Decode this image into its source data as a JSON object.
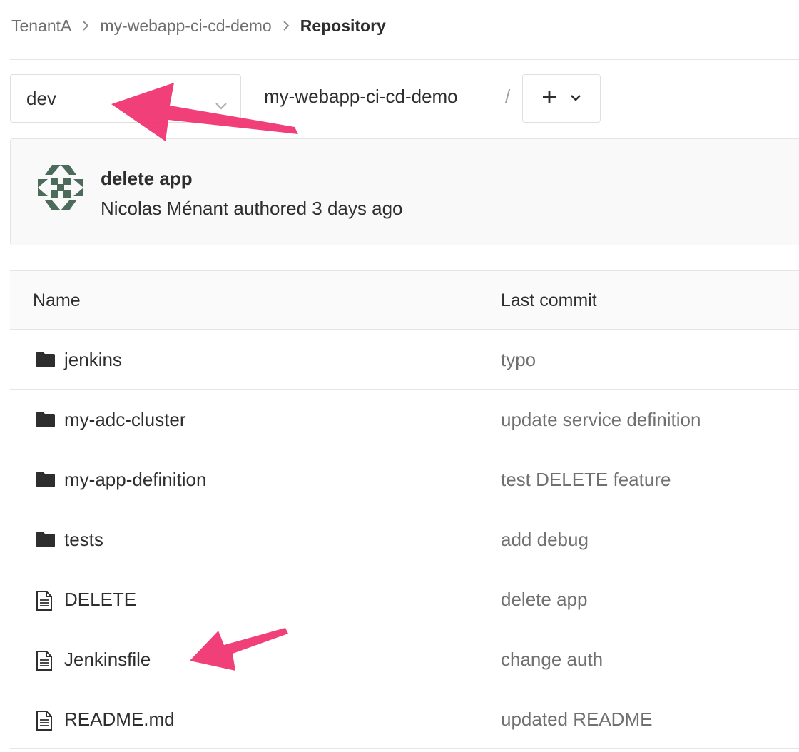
{
  "breadcrumb": {
    "items": [
      "TenantA",
      "my-webapp-ci-cd-demo"
    ],
    "current": "Repository"
  },
  "toolbar": {
    "branch": "dev",
    "path_root": "my-webapp-ci-cd-demo",
    "path_separator": "/",
    "add_icon": "plus-icon",
    "add_dropdown_icon": "chevron-down-icon"
  },
  "commit": {
    "title": "delete app",
    "meta": "Nicolas Ménant authored 3 days ago",
    "avatar_icon": "identicon-avatar",
    "avatar_color": "#4d6b5a"
  },
  "table": {
    "headers": [
      "Name",
      "Last commit"
    ],
    "rows": [
      {
        "type": "folder",
        "name": "jenkins",
        "last_commit": "typo"
      },
      {
        "type": "folder",
        "name": "my-adc-cluster",
        "last_commit": "update service definition"
      },
      {
        "type": "folder",
        "name": "my-app-definition",
        "last_commit": "test DELETE feature"
      },
      {
        "type": "folder",
        "name": "tests",
        "last_commit": "add debug"
      },
      {
        "type": "file",
        "name": "DELETE",
        "last_commit": "delete app"
      },
      {
        "type": "file",
        "name": "Jenkinsfile",
        "last_commit": "change auth"
      },
      {
        "type": "file",
        "name": "README.md",
        "last_commit": "updated README"
      }
    ]
  },
  "annotations": {
    "arrow_color": "#f0306e"
  }
}
